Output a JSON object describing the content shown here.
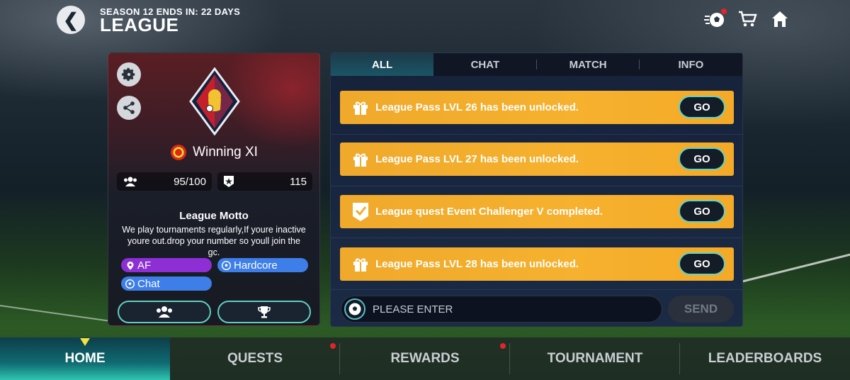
{
  "header": {
    "season_text": "SEASON 12 ENDS IN: 22 DAYS",
    "title": "LEAGUE",
    "back_icon": "chevron-left-icon",
    "icons": [
      "soccer-ball-notification-icon",
      "cart-icon",
      "home-icon"
    ]
  },
  "club": {
    "name": "Winning XI",
    "members": "95/100",
    "rank_points": "115",
    "motto_title": "League Motto",
    "motto_text": "We play tournaments regularly,If youre inactive youre out.drop your number so youll join the gc.",
    "tags": [
      {
        "label": "AF",
        "icon": "location-pin-icon",
        "color": "#8e2fd6"
      },
      {
        "label": "Hardcore",
        "icon": "soccer-ball-icon",
        "color": "#3e7ee8"
      },
      {
        "label": "Chat",
        "icon": "soccer-ball-icon",
        "color": "#3e7ee8"
      }
    ]
  },
  "feed": {
    "tabs": [
      "ALL",
      "CHAT",
      "MATCH",
      "INFO"
    ],
    "active_tab": "ALL",
    "notices": [
      {
        "text": "League Pass LVL 26 has been unlocked.",
        "icon": "gift-icon",
        "button": "GO"
      },
      {
        "text": "League Pass LVL 27 has been unlocked.",
        "icon": "gift-icon",
        "button": "GO"
      },
      {
        "text": "League quest Event Challenger V completed.",
        "icon": "checkmark-badge-icon",
        "button": "GO"
      },
      {
        "text": "League Pass LVL 28 has been unlocked.",
        "icon": "gift-icon",
        "button": "GO"
      }
    ],
    "chat_placeholder": "PLEASE ENTER",
    "send_label": "SEND"
  },
  "nav": {
    "items": [
      "HOME",
      "QUESTS",
      "REWARDS",
      "TOURNAMENT",
      "LEADERBOARDS"
    ],
    "active": "HOME",
    "dots": [
      "QUESTS",
      "REWARDS"
    ]
  },
  "colors": {
    "accent_teal": "#5fd0c0",
    "notice_orange": "#f6b12f",
    "nav_indicator": "#f5e33c",
    "alert_red": "#e3242b"
  }
}
